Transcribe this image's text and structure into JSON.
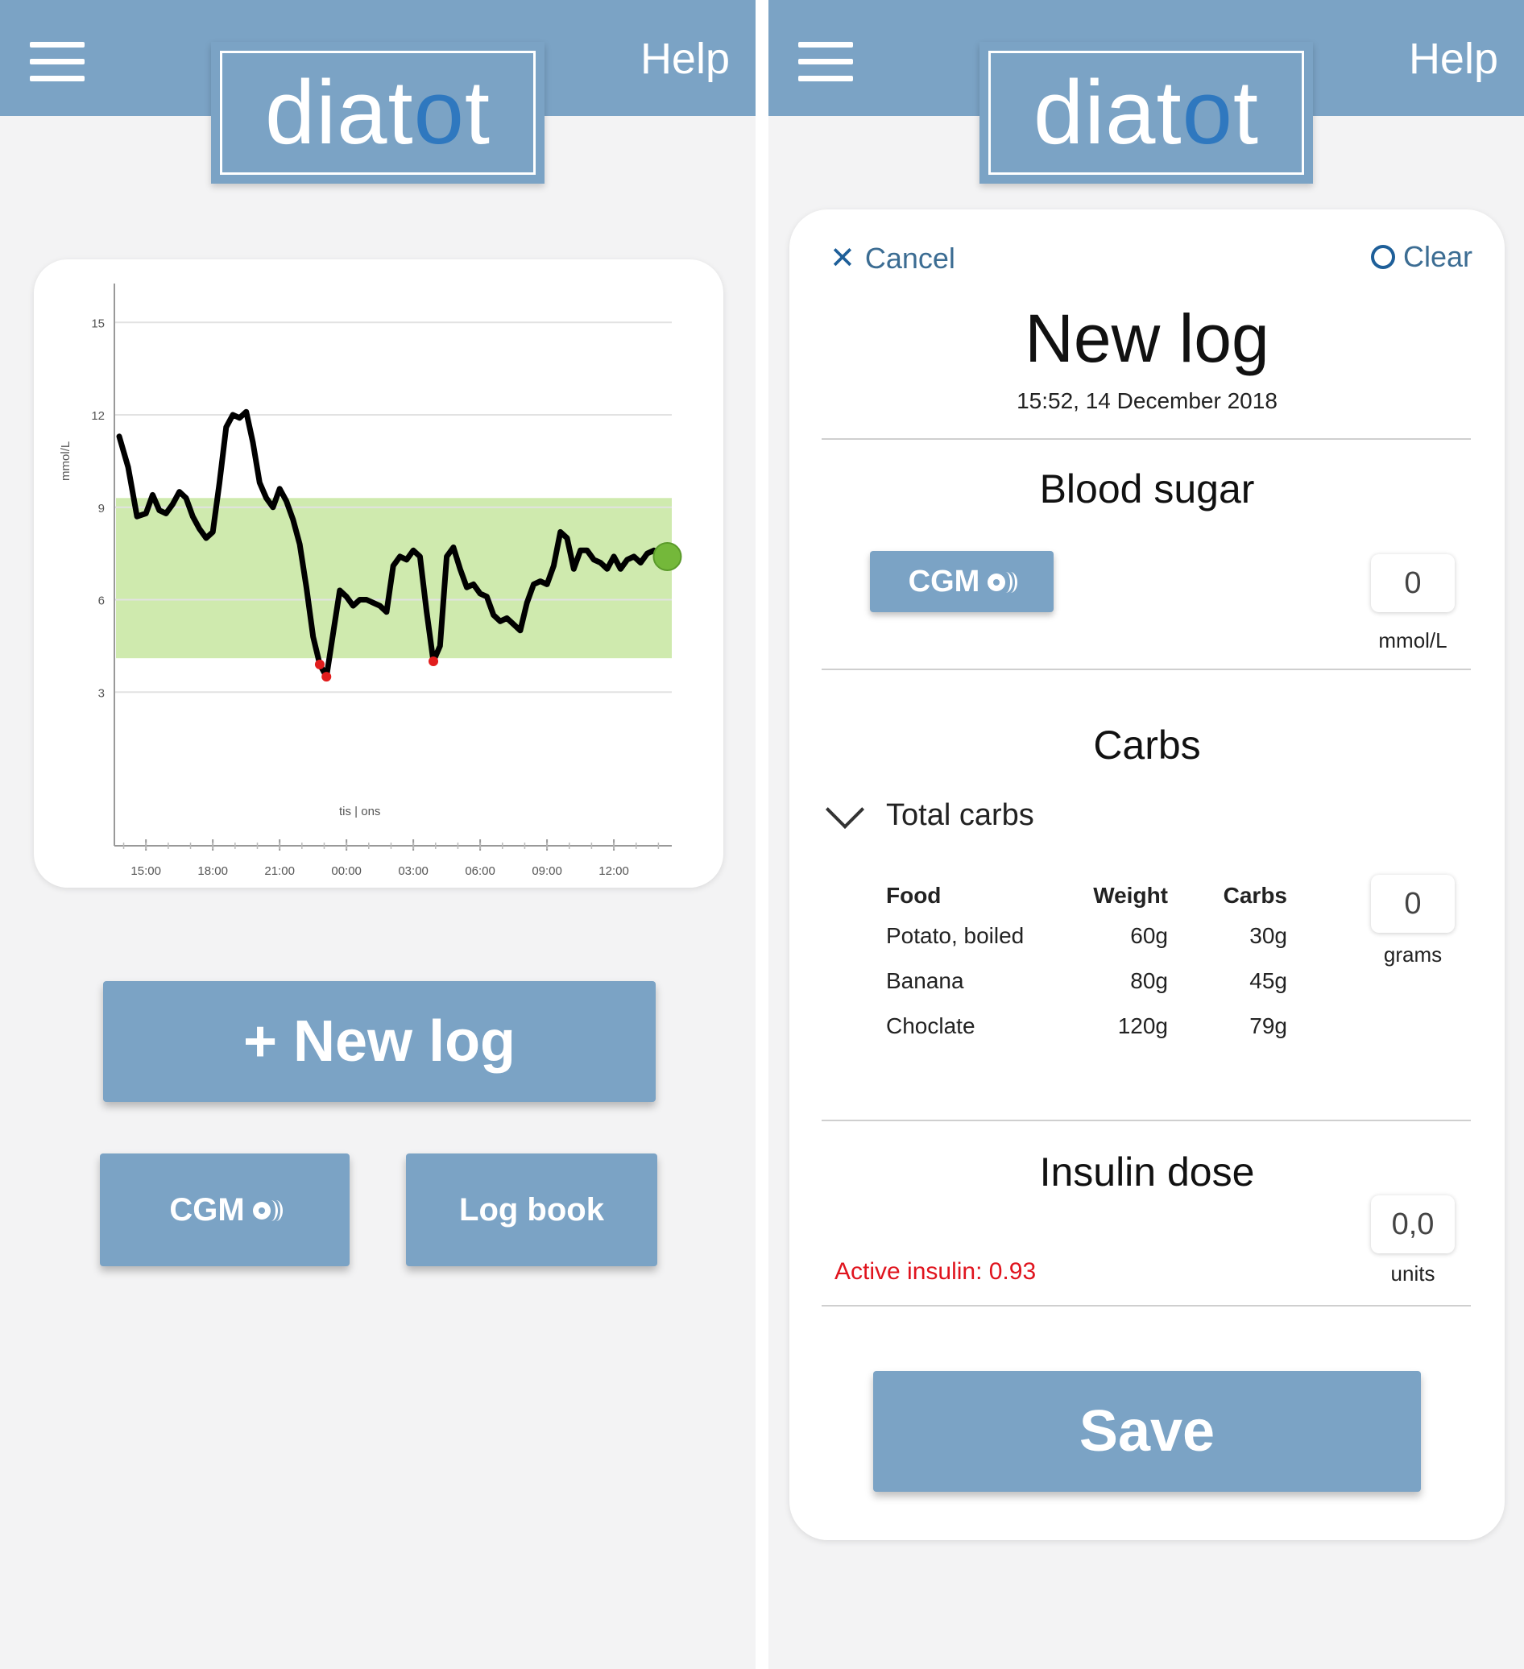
{
  "home": {
    "logo": {
      "pre": "diat",
      "o": "o",
      "post": "t"
    },
    "help_label": "Help",
    "buttons": {
      "new_log": "+ New log",
      "cgm": "CGM",
      "log_book": "Log book"
    },
    "chart_data": {
      "type": "line",
      "title": "",
      "ylabel": "mmol/L",
      "xlabel": "tis | ons",
      "ylim": [
        0,
        16
      ],
      "y_ticks": [
        3,
        6,
        9,
        12,
        15
      ],
      "x_tick_labels": [
        "15:00",
        "18:00",
        "21:00",
        "00:00",
        "03:00",
        "06:00",
        "09:00",
        "12:00"
      ],
      "x_range_hours": [
        13.8,
        38.6
      ],
      "target_range": [
        4.1,
        9.3
      ],
      "target_color": "#cfeaae",
      "line_color": "#000000",
      "low_color": "#e11d1d",
      "current_marker_color": "#74b83a",
      "grid": true,
      "series": [
        {
          "x": [
            13.8,
            14.2,
            14.6,
            15,
            15.3,
            15.6,
            15.9,
            16.2,
            16.5,
            16.8,
            17.1,
            17.4,
            17.7,
            18.0,
            18.3,
            18.6,
            18.9,
            19.2,
            19.5,
            19.8,
            20.1,
            20.4,
            20.7,
            21.0,
            21.3,
            21.6,
            21.9,
            22.2,
            22.5,
            22.8,
            23.1,
            23.4,
            23.7,
            24.0,
            24.3,
            24.6,
            24.9,
            25.2,
            25.5,
            25.8,
            26.1,
            26.4,
            26.7,
            27.0,
            27.3,
            27.6,
            27.9,
            28.2,
            28.5,
            28.8,
            29.1,
            29.4,
            29.7,
            30.0,
            30.3,
            30.6,
            30.9,
            31.2,
            31.5,
            31.8,
            32.1,
            32.4,
            32.7,
            33.0,
            33.3,
            33.6,
            33.9,
            34.2,
            34.5,
            34.8,
            35.1,
            35.4,
            35.7,
            36.0,
            36.3,
            36.6,
            36.9,
            37.2,
            37.5,
            37.8,
            38.1,
            38.4
          ],
          "y": [
            11.3,
            10.3,
            8.7,
            8.8,
            9.4,
            8.9,
            8.8,
            9.1,
            9.5,
            9.3,
            8.7,
            8.3,
            8.0,
            8.2,
            9.8,
            11.6,
            12.0,
            11.9,
            12.1,
            11.1,
            9.8,
            9.3,
            9.0,
            9.6,
            9.2,
            8.6,
            7.8,
            6.4,
            4.8,
            3.9,
            3.5,
            4.9,
            6.3,
            6.1,
            5.8,
            6.0,
            6.0,
            5.9,
            5.8,
            5.6,
            7.1,
            7.4,
            7.3,
            7.6,
            7.4,
            5.6,
            4.0,
            4.5,
            7.4,
            7.7,
            7.0,
            6.4,
            6.5,
            6.2,
            6.1,
            5.5,
            5.3,
            5.4,
            5.2,
            5.0,
            5.9,
            6.5,
            6.6,
            6.5,
            7.1,
            8.2,
            8.0,
            7.0,
            7.6,
            7.6,
            7.3,
            7.2,
            7.0,
            7.4,
            7.0,
            7.3,
            7.4,
            7.2,
            7.5,
            7.6,
            7.2,
            7.4
          ]
        }
      ]
    }
  },
  "log": {
    "logo": {
      "pre": "diat",
      "o": "o",
      "post": "t"
    },
    "help_label": "Help",
    "cancel_label": "Cancel",
    "clear_label": "Clear",
    "title": "New log",
    "datetime": "15:52, 14 December 2018",
    "blood_sugar": {
      "title": "Blood sugar",
      "cgm_label": "CGM",
      "value": "0",
      "unit": "mmol/L"
    },
    "carbs": {
      "title": "Carbs",
      "total_label": "Total carbs",
      "value": "0",
      "unit": "grams",
      "columns": [
        "Food",
        "Weight",
        "Carbs"
      ],
      "rows": [
        [
          "Potato, boiled",
          "60g",
          "30g"
        ],
        [
          "Banana",
          "80g",
          "45g"
        ],
        [
          "Choclate",
          "120g",
          "79g"
        ]
      ]
    },
    "insulin": {
      "title": "Insulin dose",
      "value": "0,0",
      "unit": "units",
      "active_label": "Active insulin: 0.93"
    },
    "save_label": "Save"
  }
}
